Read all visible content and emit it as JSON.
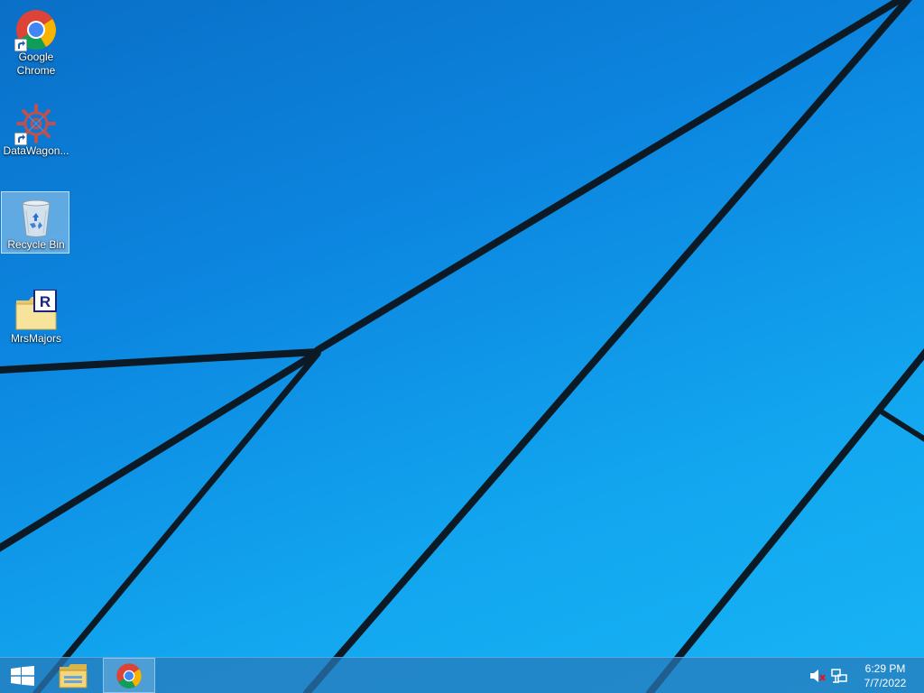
{
  "desktop": {
    "icons": [
      {
        "label": "Google Chrome",
        "icon": "chrome-icon",
        "shortcut": true
      },
      {
        "label": "DataWagon...",
        "icon": "datawagon-gear-icon",
        "shortcut": true
      },
      {
        "label": "Recycle Bin",
        "icon": "recycle-bin-icon",
        "shortcut": false,
        "selected": true
      },
      {
        "label": "MrsMajors",
        "icon": "r-folder-icon",
        "shortcut": false
      }
    ]
  },
  "taskbar": {
    "start_icon": "windows-logo-icon",
    "pinned": [
      {
        "name": "File Explorer",
        "icon": "folder-icon"
      },
      {
        "name": "Google Chrome",
        "icon": "chrome-icon",
        "active": true
      }
    ],
    "tray": {
      "volume_icon": "volume-muted-icon",
      "network_icon": "network-icon"
    },
    "clock": {
      "time": "6:29 PM",
      "date": "7/7/2022"
    }
  },
  "colors": {
    "wallpaper_dark": "#0a6fc7",
    "wallpaper_light": "#18b4f5",
    "taskbar": "#2878b9",
    "line": "#0b1a24"
  }
}
